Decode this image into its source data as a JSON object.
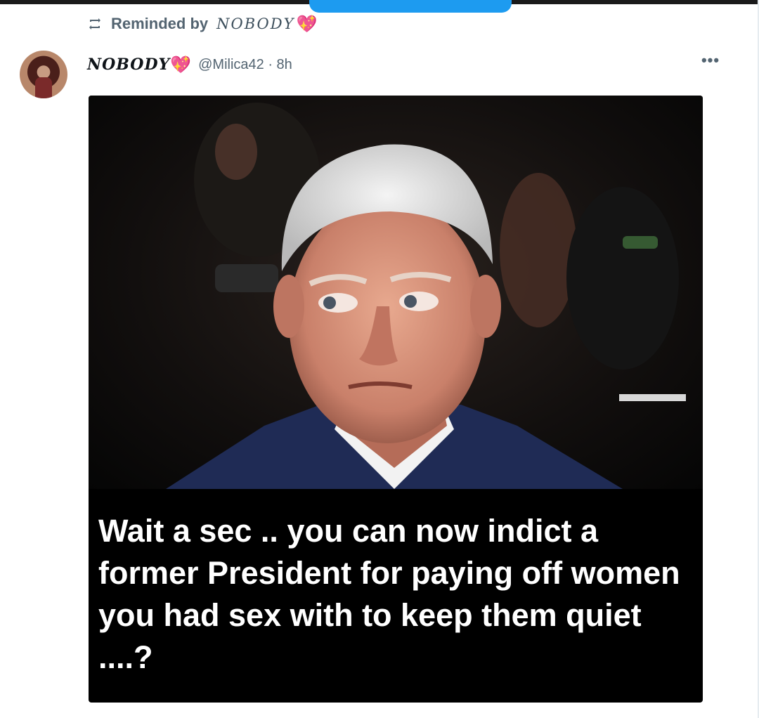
{
  "reminder": {
    "prefix": "Reminded by",
    "name": "NOBODY",
    "heart": "💖"
  },
  "tweet": {
    "display_name": "NOBODY",
    "heart": "💖",
    "handle_time": "@Milica42 · 8h",
    "more": "•••",
    "caption": "Wait a sec .. you can now indict a former President for paying off women you had sex with to keep them quiet ....?"
  },
  "colors": {
    "accent": "#1d9bf0",
    "heart": "#e9438f",
    "secondary_text": "#536471"
  }
}
